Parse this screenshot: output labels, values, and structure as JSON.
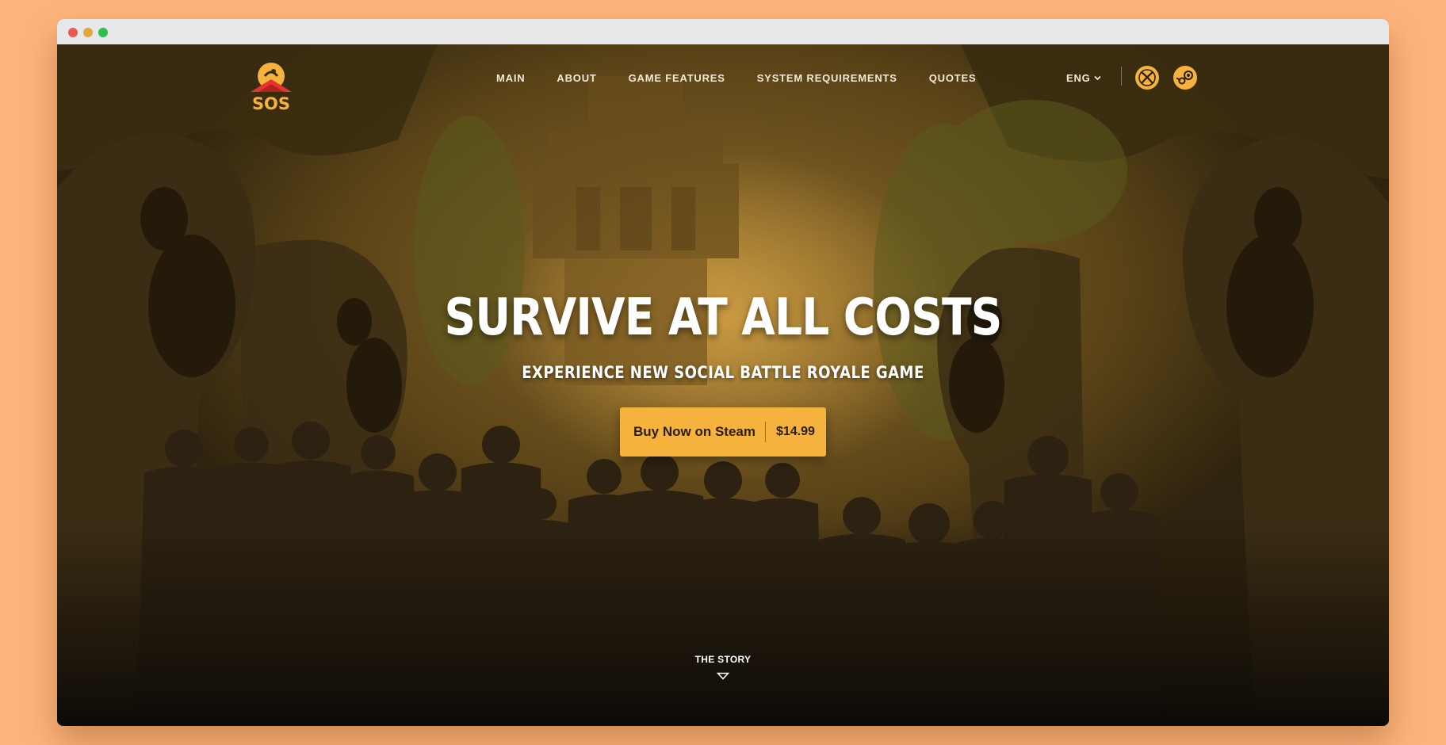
{
  "browser": {
    "controls": [
      "close",
      "minimize",
      "maximize"
    ]
  },
  "nav": {
    "logo_text": "SOS",
    "items": [
      {
        "label": "MAIN"
      },
      {
        "label": "ABOUT"
      },
      {
        "label": "GAME FEATURES"
      },
      {
        "label": "SYSTEM REQUIREMENTS"
      },
      {
        "label": "QUOTES"
      }
    ],
    "language": "ENG",
    "platform_icons": [
      "xbox-icon",
      "steam-icon"
    ]
  },
  "hero": {
    "title": "SURVIVE AT ALL COSTS",
    "subtitle": "EXPERIENCE NEW SOCIAL BATTLE ROYALE GAME",
    "buy_label": "Buy Now on Steam",
    "price": "$14.99",
    "scroll_label": "THE STORY"
  },
  "colors": {
    "page_background": "#fdb47c",
    "accent": "#f5b23d",
    "logo_red": "#e3342f",
    "text_light": "#f3ead7"
  }
}
